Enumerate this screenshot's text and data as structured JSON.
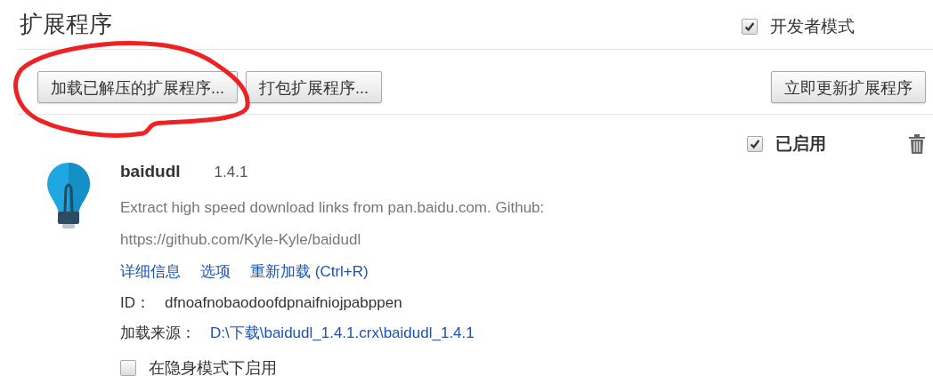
{
  "page": {
    "title": "扩展程序",
    "developer_mode": {
      "label": "开发者模式",
      "checked": true
    }
  },
  "toolbar": {
    "buttons": [
      "加载已解压的扩展程序...",
      "打包扩展程序..."
    ],
    "update_button": "立即更新扩展程序"
  },
  "annotation": {
    "kind": "circle",
    "color": "#ee2222"
  },
  "extensions": [
    {
      "name": "baidudl",
      "version": "1.4.1",
      "description": "Extract high speed download links from pan.baidu.com. Github: https://github.com/Kyle-Kyle/baidudl",
      "links": [
        "详细信息",
        "选项",
        "重新加载 (Ctrl+R)"
      ],
      "id_label": "ID：",
      "id": "dfnoafnobaodoofdpnaifniojpabppen",
      "source_label": "加载来源：",
      "source": "D:\\下载\\baidudl_1.4.1.crx\\baidudl_1.4.1",
      "enabled": {
        "label": "已启用",
        "checked": true
      },
      "incognito": {
        "label": "在隐身模式下启用",
        "checked": false
      }
    }
  ]
}
